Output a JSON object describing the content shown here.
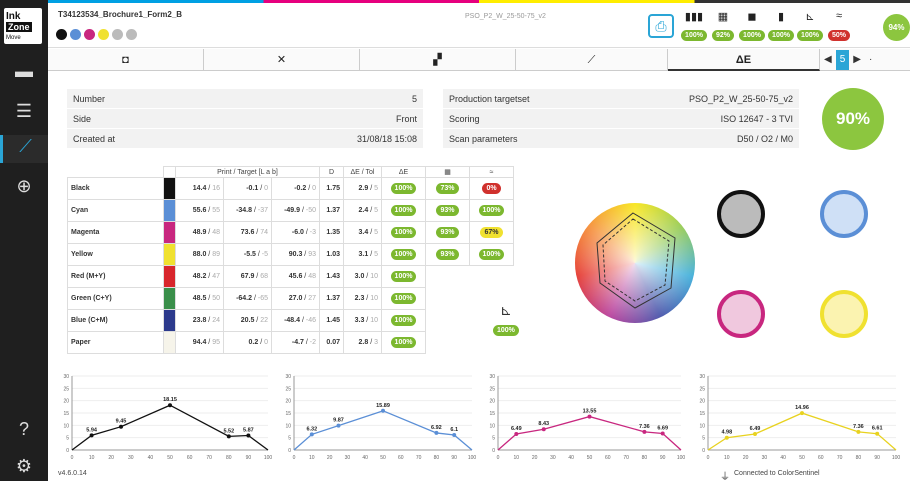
{
  "app": {
    "logo_lines": [
      "Ink",
      "Zone",
      "Move"
    ],
    "version": "v4.6.0.14",
    "connection": "Connected to ColorSentinel"
  },
  "job": {
    "name": "T34123534_Brochure1_Form2_B",
    "reference": "PSO_P2_W_25-50-75_v2",
    "ink_dots": [
      "#111111",
      "#5b8fd6",
      "#c8277f",
      "#f0e130",
      "#bbbbbb",
      "#bbbbbb"
    ]
  },
  "status": [
    {
      "icon": "▮▮▮",
      "value": "100%",
      "kind": "green"
    },
    {
      "icon": "▦",
      "value": "92%",
      "kind": "green"
    },
    {
      "icon": "◼",
      "value": "100%",
      "kind": "green"
    },
    {
      "icon": "▮",
      "value": "100%",
      "kind": "green"
    },
    {
      "icon": "⊾",
      "value": "100%",
      "kind": "green"
    },
    {
      "icon": "≈",
      "value": "50%",
      "kind": "red"
    }
  ],
  "overall_badge": "94%",
  "tabs": [
    {
      "label": "◘",
      "name": "tab-density"
    },
    {
      "label": "✕",
      "name": "tab-trapping"
    },
    {
      "label": "▞",
      "name": "tab-balance"
    },
    {
      "label": "⟋",
      "name": "tab-curves"
    },
    {
      "label": "ΔE",
      "name": "tab-delta-e"
    }
  ],
  "pager": {
    "prev": "◀",
    "page": "5",
    "next": "▶",
    "more": "·"
  },
  "info_left": [
    {
      "label": "Number",
      "value": "5"
    },
    {
      "label": "Side",
      "value": "Front"
    },
    {
      "label": "Created at",
      "value": "31/08/18 15:08"
    }
  ],
  "info_right": [
    {
      "label": "Production targetset",
      "value": "PSO_P2_W_25-50-75_v2"
    },
    {
      "label": "Scoring",
      "value": "ISO 12647 - 3 TVI"
    },
    {
      "label": "Scan parameters",
      "value": "D50 / O2 / M0"
    }
  ],
  "score": "90%",
  "table": {
    "headers": {
      "lab": "Print / Target [L a b]",
      "d": "D",
      "de": "ΔE / Tol",
      "de_icon": "ΔE",
      "grid_icon": "▦",
      "wave_icon": "≈"
    },
    "rows": [
      {
        "name": "Black",
        "color": "#111111",
        "L": "14.4",
        "Lt": "16",
        "a": "-0.1",
        "at": "0",
        "b": "-0.2",
        "bt": "0",
        "D": "1.75",
        "de": "2.9",
        "tol": "5",
        "p1": "100%",
        "p2": "73%",
        "p3": "0%",
        "p3k": "red"
      },
      {
        "name": "Cyan",
        "color": "#5b8fd6",
        "L": "55.6",
        "Lt": "55",
        "a": "-34.8",
        "at": "-37",
        "b": "-49.9",
        "bt": "-50",
        "D": "1.37",
        "de": "2.4",
        "tol": "5",
        "p1": "100%",
        "p2": "93%",
        "p3": "100%",
        "p3k": "green"
      },
      {
        "name": "Magenta",
        "color": "#c8277f",
        "L": "48.9",
        "Lt": "48",
        "a": "73.6",
        "at": "74",
        "b": "-6.0",
        "bt": "-3",
        "D": "1.35",
        "de": "3.4",
        "tol": "5",
        "p1": "100%",
        "p2": "93%",
        "p3": "67%",
        "p3k": "yel"
      },
      {
        "name": "Yellow",
        "color": "#f0e130",
        "L": "88.0",
        "Lt": "89",
        "a": "-5.5",
        "at": "-5",
        "b": "90.3",
        "bt": "93",
        "D": "1.03",
        "de": "3.1",
        "tol": "5",
        "p1": "100%",
        "p2": "93%",
        "p3": "100%",
        "p3k": "green"
      },
      {
        "name": "Red (M+Y)",
        "color": "#d8262c",
        "L": "48.2",
        "Lt": "47",
        "a": "67.9",
        "at": "68",
        "b": "45.6",
        "bt": "48",
        "D": "1.43",
        "de": "3.0",
        "tol": "10",
        "p1": "100%"
      },
      {
        "name": "Green (C+Y)",
        "color": "#3a8f4a",
        "L": "48.5",
        "Lt": "50",
        "a": "-64.2",
        "at": "-65",
        "b": "27.0",
        "bt": "27",
        "D": "1.37",
        "de": "2.3",
        "tol": "10",
        "p1": "100%"
      },
      {
        "name": "Blue (C+M)",
        "color": "#2c3a8c",
        "L": "23.8",
        "Lt": "24",
        "a": "20.5",
        "at": "22",
        "b": "-48.4",
        "bt": "-46",
        "D": "1.45",
        "de": "3.3",
        "tol": "10",
        "p1": "100%"
      },
      {
        "name": "Paper",
        "color": "#f6f4ea",
        "L": "94.4",
        "Lt": "95",
        "a": "0.2",
        "at": "0",
        "b": "-4.7",
        "bt": "-2",
        "D": "0.07",
        "de": "2.8",
        "tol": "3",
        "p1": "100%"
      }
    ],
    "balance_badge": "100%"
  },
  "chart_data": [
    {
      "type": "line",
      "series_color": "#111111",
      "x": [
        10,
        25,
        50,
        80,
        90
      ],
      "y": [
        5.94,
        9.45,
        18.15,
        5.52,
        5.87
      ],
      "labels": [
        "5.94",
        "9.45",
        "18.15",
        "5.52",
        "5.87"
      ],
      "xlim": [
        0,
        100
      ],
      "ylim": [
        0,
        30
      ],
      "xticks": [
        "0",
        "10",
        "20",
        "30",
        "40",
        "50",
        "60",
        "70",
        "80",
        "90",
        "100"
      ],
      "yticks": [
        "0",
        "5",
        "10",
        "15",
        "20",
        "25",
        "30"
      ]
    },
    {
      "type": "line",
      "series_color": "#5b8fd6",
      "x": [
        10,
        25,
        50,
        80,
        90
      ],
      "y": [
        6.32,
        9.87,
        15.89,
        6.92,
        6.1
      ],
      "labels": [
        "6.32",
        "9.87",
        "15.89",
        "6.92",
        "6.1"
      ],
      "xlim": [
        0,
        100
      ],
      "ylim": [
        0,
        30
      ],
      "xticks": [
        "0",
        "10",
        "20",
        "30",
        "40",
        "50",
        "60",
        "70",
        "80",
        "90",
        "100"
      ],
      "yticks": [
        "0",
        "5",
        "10",
        "15",
        "20",
        "25",
        "30"
      ]
    },
    {
      "type": "line",
      "series_color": "#c8277f",
      "x": [
        10,
        25,
        50,
        80,
        90
      ],
      "y": [
        6.49,
        8.43,
        13.55,
        7.36,
        6.69
      ],
      "labels": [
        "6.49",
        "8.43",
        "13.55",
        "7.36",
        "6.69"
      ],
      "xlim": [
        0,
        100
      ],
      "ylim": [
        0,
        30
      ],
      "xticks": [
        "0",
        "10",
        "20",
        "30",
        "40",
        "50",
        "60",
        "70",
        "80",
        "90",
        "100"
      ],
      "yticks": [
        "0",
        "5",
        "10",
        "15",
        "20",
        "25",
        "30"
      ]
    },
    {
      "type": "line",
      "series_color": "#e8d21f",
      "x": [
        10,
        25,
        50,
        80,
        90
      ],
      "y": [
        4.98,
        6.49,
        14.96,
        7.36,
        6.61
      ],
      "labels": [
        "4.98",
        "6.49",
        "14.96",
        "7.36",
        "6.61"
      ],
      "xlim": [
        0,
        100
      ],
      "ylim": [
        0,
        30
      ],
      "xticks": [
        "0",
        "10",
        "20",
        "30",
        "40",
        "50",
        "60",
        "70",
        "80",
        "90",
        "100"
      ],
      "yticks": [
        "0",
        "5",
        "10",
        "15",
        "20",
        "25",
        "30"
      ]
    }
  ]
}
